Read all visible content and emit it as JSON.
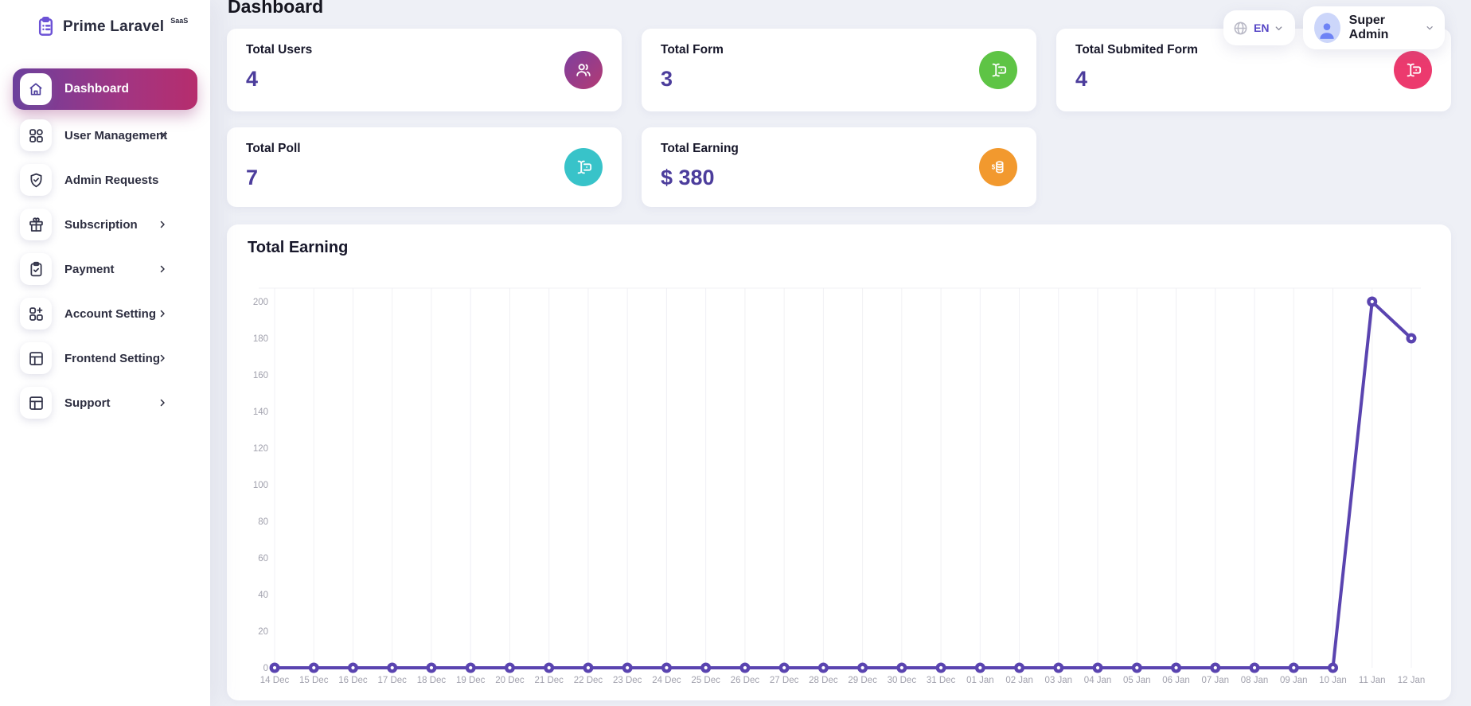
{
  "app": {
    "brand": "Prime Laravel",
    "brand_badge": "SaaS"
  },
  "header": {
    "page_title": "Dashboard",
    "language": {
      "code": "EN",
      "icon": "globe-icon"
    },
    "user": {
      "name": "Super Admin",
      "icon": "avatar-person-icon"
    }
  },
  "sidebar": {
    "active_item": {
      "label": "Dashboard",
      "icon": "home-icon"
    },
    "items": [
      {
        "label": "User Management",
        "icon": "grid-icon",
        "has_chevron": true
      },
      {
        "label": "Admin Requests",
        "icon": "shield-check-icon",
        "has_chevron": false
      },
      {
        "label": "Subscription",
        "icon": "gift-icon",
        "has_chevron": true
      },
      {
        "label": "Payment",
        "icon": "clipboard-check-icon",
        "has_chevron": true
      },
      {
        "label": "Account Setting",
        "icon": "grid-plus-icon",
        "has_chevron": true
      },
      {
        "label": "Frontend Setting",
        "icon": "layout-icon",
        "has_chevron": true
      },
      {
        "label": "Support",
        "icon": "layout-icon",
        "has_chevron": true
      }
    ]
  },
  "stats": [
    {
      "label": "Total Users",
      "value": "4",
      "icon": "users-icon",
      "icon_bg": "linear-gradient(135deg,#7d3f9f 0%,#b33a73 100%)"
    },
    {
      "label": "Total Form",
      "value": "3",
      "icon": "form-input-icon",
      "icon_bg": "#5ec445"
    },
    {
      "label": "Total Submited Form",
      "value": "4",
      "icon": "form-input-icon",
      "icon_bg": "#ec3a6e"
    },
    {
      "label": "Total Poll",
      "value": "7",
      "icon": "form-input-icon",
      "icon_bg": "#38c3c9"
    },
    {
      "label": "Total Earning",
      "value": "$ 380",
      "icon": "coins-icon",
      "icon_bg": "#f2992e"
    }
  ],
  "chart_card": {
    "title": "Total Earning"
  },
  "chart_data": {
    "type": "line",
    "title": "Total Earning",
    "x": [
      "14 Dec",
      "15 Dec",
      "16 Dec",
      "17 Dec",
      "18 Dec",
      "19 Dec",
      "20 Dec",
      "21 Dec",
      "22 Dec",
      "23 Dec",
      "24 Dec",
      "25 Dec",
      "26 Dec",
      "27 Dec",
      "28 Dec",
      "29 Dec",
      "30 Dec",
      "31 Dec",
      "01 Jan",
      "02 Jan",
      "03 Jan",
      "04 Jan",
      "05 Jan",
      "06 Jan",
      "07 Jan",
      "08 Jan",
      "09 Jan",
      "10 Jan",
      "11 Jan",
      "12 Jan"
    ],
    "values": [
      0,
      0,
      0,
      0,
      0,
      0,
      0,
      0,
      0,
      0,
      0,
      0,
      0,
      0,
      0,
      0,
      0,
      0,
      0,
      0,
      0,
      0,
      0,
      0,
      0,
      0,
      0,
      0,
      200,
      180
    ],
    "ylim": [
      0,
      200
    ],
    "ytick_step": 20,
    "line_color": "#5a44b0",
    "marker_style": "donut",
    "grid": "vertical-only",
    "legend": "none",
    "xlabel": "",
    "ylabel": ""
  },
  "colors": {
    "page_bg": "#eef0f6",
    "accent_purple": "#4c3d9c",
    "active_gradient_start": "#6c3f9d",
    "active_gradient_end": "#b62d6d",
    "chart_line": "#5a44b0",
    "tick_text": "#a1a1ad"
  }
}
